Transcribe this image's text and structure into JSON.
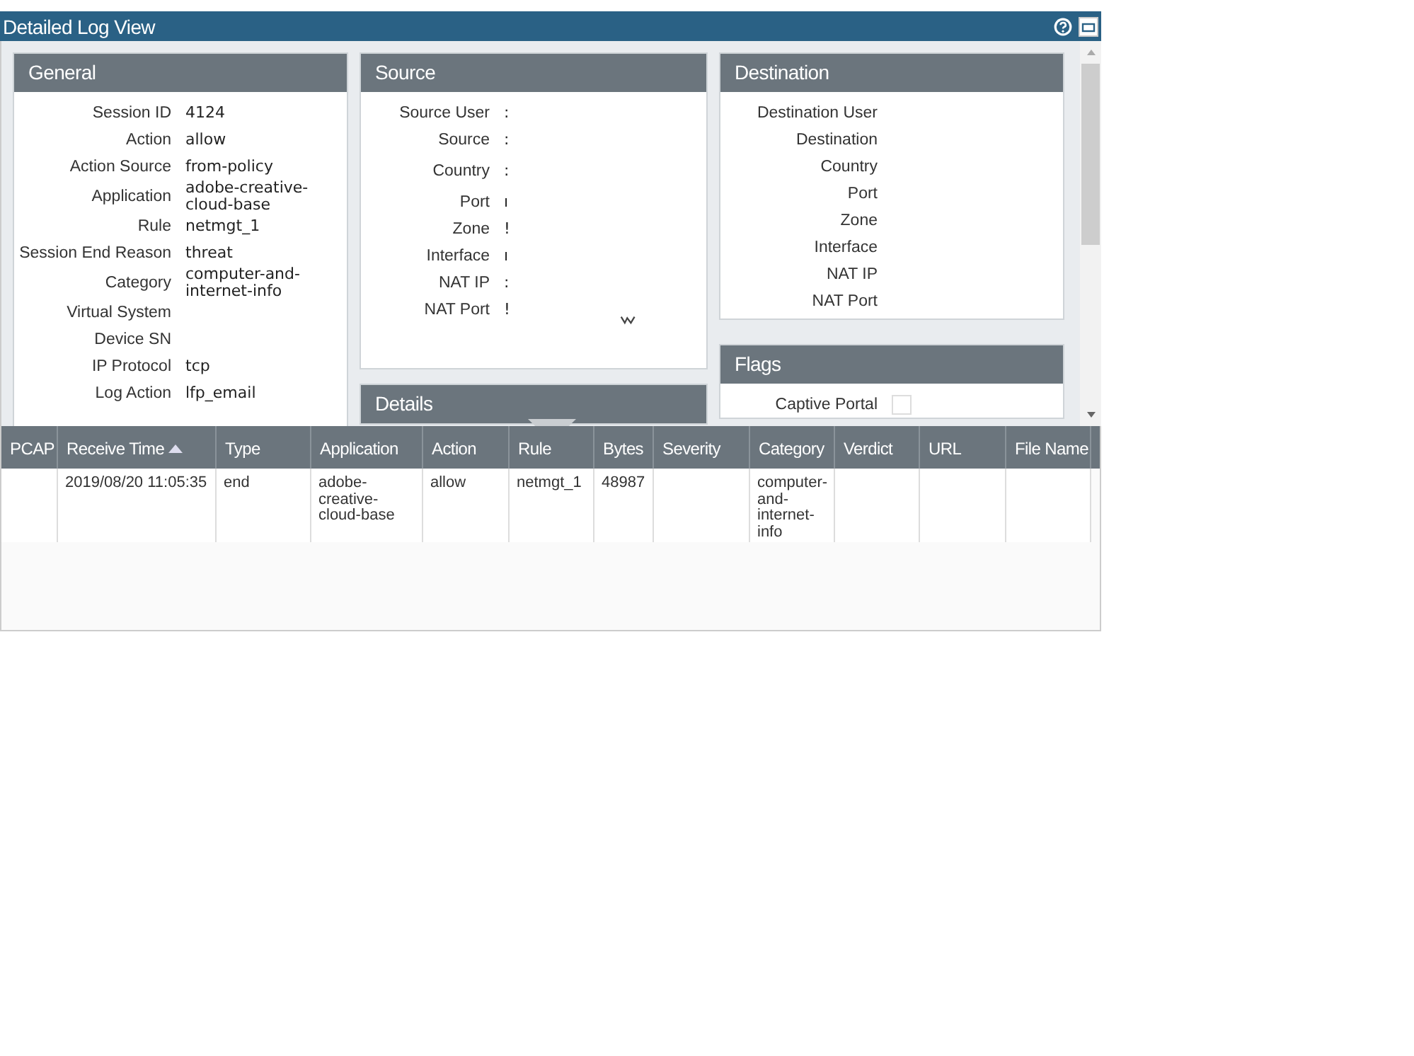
{
  "window": {
    "title": "Detailed Log View"
  },
  "general": {
    "title": "General",
    "rows": [
      {
        "label": "Session ID",
        "value": "4124"
      },
      {
        "label": "Action",
        "value": "allow"
      },
      {
        "label": "Action Source",
        "value": "from-policy"
      },
      {
        "label": "Application",
        "value": "adobe-creative-cloud-base"
      },
      {
        "label": "Rule",
        "value": "netmgt_1"
      },
      {
        "label": "Session End Reason",
        "value": "threat"
      },
      {
        "label": "Category",
        "value": "computer-and-internet-info"
      },
      {
        "label": "Virtual System",
        "value": ""
      },
      {
        "label": "Device SN",
        "value": ""
      },
      {
        "label": "IP Protocol",
        "value": "tcp"
      },
      {
        "label": "Log Action",
        "value": "lfp_email"
      }
    ]
  },
  "source": {
    "title": "Source",
    "rows": [
      {
        "label": "Source User",
        "value": ":"
      },
      {
        "label": "Source",
        "value": ":"
      },
      {
        "label": "Country",
        "value": ":"
      },
      {
        "label": "Port",
        "value": "ı"
      },
      {
        "label": "Zone",
        "value": "!"
      },
      {
        "label": "Interface",
        "value": "ı"
      },
      {
        "label": "NAT IP",
        "value": ":"
      },
      {
        "label": "NAT Port",
        "value": "!"
      }
    ]
  },
  "details": {
    "title": "Details"
  },
  "destination": {
    "title": "Destination",
    "rows": [
      {
        "label": "Destination User"
      },
      {
        "label": "Destination"
      },
      {
        "label": "Country"
      },
      {
        "label": "Port"
      },
      {
        "label": "Zone"
      },
      {
        "label": "Interface"
      },
      {
        "label": "NAT IP"
      },
      {
        "label": "NAT Port"
      }
    ]
  },
  "flags": {
    "title": "Flags",
    "rows": [
      {
        "label": "Captive Portal",
        "checked": false
      }
    ]
  },
  "table": {
    "columns": [
      {
        "label": "PCAP"
      },
      {
        "label": "Receive Time",
        "sorted": true
      },
      {
        "label": "Type"
      },
      {
        "label": "Application"
      },
      {
        "label": "Action"
      },
      {
        "label": "Rule"
      },
      {
        "label": "Bytes"
      },
      {
        "label": "Severity"
      },
      {
        "label": "Category"
      },
      {
        "label": "Verdict"
      },
      {
        "label": "URL"
      },
      {
        "label": "File Name"
      }
    ],
    "rows": [
      {
        "cells": [
          "",
          "2019/08/20 11:05:35",
          "end",
          "adobe-creative-cloud-base",
          "allow",
          "netmgt_1",
          "48987",
          "",
          "computer-and-internet-info",
          "",
          "",
          ""
        ]
      }
    ]
  }
}
